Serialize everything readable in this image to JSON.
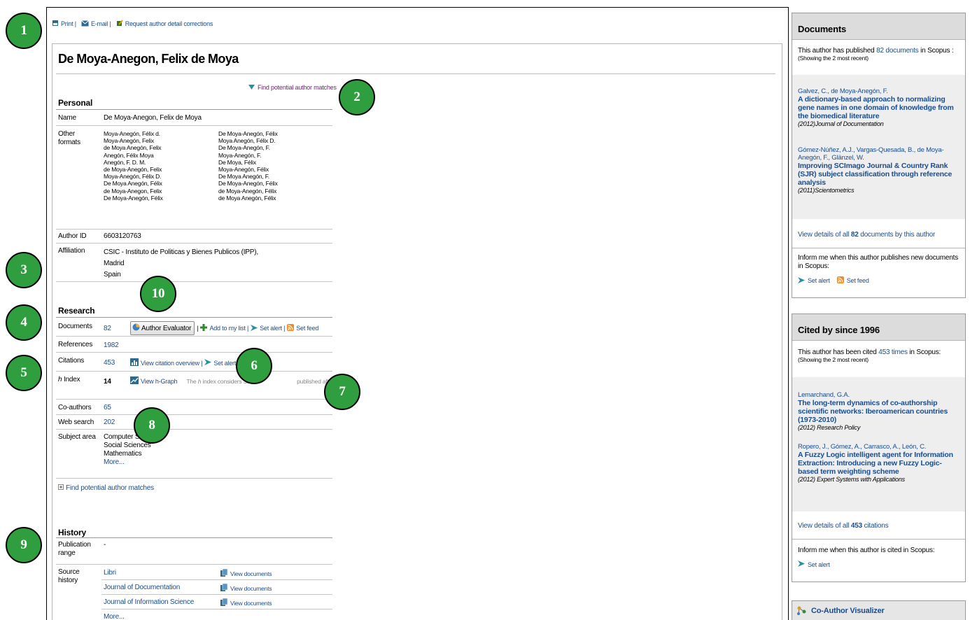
{
  "toolbar": {
    "print": "Print |",
    "email": "E-mail |",
    "request": "Request author detail corrections"
  },
  "author_name": "De Moya-Anegon, Felix de Moya",
  "find_matches_top": "Find potential author matches",
  "personal": {
    "heading": "Personal",
    "name_label": "Name",
    "name_value": "De Moya-Anegon, Felix de Moya",
    "other_label_1": "Other",
    "other_label_2": "formats",
    "formats_col1": [
      "Moya-Anegón, Félix d.",
      "Moya-Anegón, Felix",
      "de Moya Anegón, Felix",
      "Anegón, Félix Moya",
      "Anegón, F. D. M.",
      "de Moya-Anegón, Felix",
      "Moya-Anegón, Félix D.",
      "De Moya Anegón, Félix",
      "de Moya-Anegon, Felix",
      "De Moya-Anegón, Félix"
    ],
    "formats_col2": [
      "De Moya-Anegón, Félix",
      "Moya Anegón, Félix D.",
      "De Moya-Anegón, F.",
      "Moya-Anegón, F.",
      "De Moya, Félix",
      "Moya-Anegón, Félix",
      "De Moya Anegón, F.",
      "De Moya-Anegón, Félix",
      "de Moya-Anegón, Félix",
      "de Moya Anegón, Félix"
    ],
    "author_id_label": "Author ID",
    "author_id": "6603120763",
    "affiliation_label": "Affiliation",
    "affiliation": [
      "CSIC - Instituto de Politicas y Bienes Publicos (IPP),",
      "Madrid",
      "Spain"
    ]
  },
  "research": {
    "heading": "Research",
    "documents_label": "Documents",
    "documents_value": "82",
    "author_evaluator": "Author Evaluator",
    "sep1": "|",
    "add_to_list": "Add to my list |",
    "set_alert_docs": "Set alert |",
    "set_feed": "Set feed",
    "references_label": "References",
    "references_value": "1982",
    "citations_label": "Citations",
    "citations_value": "453",
    "view_citation_overview": "View citation overview |",
    "set_alert_cit": "Set alert",
    "hindex_label_h": "h",
    "hindex_label_rest": " Index",
    "hindex_value": "14",
    "view_hgraph": "View h-Graph",
    "hindex_note_1": "The",
    "hindex_note_h": "h",
    "hindex_note_2": "index considers Sc",
    "hindex_note_3": "published after 1995.",
    "coauthors_label": "Co-authors",
    "coauthors_value": "65",
    "websearch_label": "Web search",
    "websearch_value": "202",
    "subject_label": "Subject area",
    "subjects": [
      "Computer S",
      "Social Sciences",
      "Mathematics"
    ],
    "subjects_more": "More...",
    "find_matches": "Find potential author matches"
  },
  "history": {
    "heading": "History",
    "pub_label_1": "Publication",
    "pub_label_2": "range",
    "pub_value": "-",
    "source_label_1": "Source",
    "source_label_2": "history",
    "sources": [
      "Libri",
      "Journal of Documentation",
      "Journal of Information Science"
    ],
    "view_documents": "View documents",
    "more": "More..."
  },
  "documents_panel": {
    "title": "Documents",
    "intro_1": "This author has published",
    "intro_link": "82 documents",
    "intro_2": "in Scopus :",
    "showing": "(Showing the 2 most recent)",
    "items": [
      {
        "authors": "Galvez, C., de Moya-Anegón, F.",
        "title": "A dictionary-based approach to normalizing gene names in one domain of knowledge from the biomedical literature",
        "source": "(2012)Journal of Documentation"
      },
      {
        "authors": "Gómez-Núñez, A.J., Vargas-Quesada, B., de Moya-Anegón, F., Glänzel, W.",
        "title": "Improving SCImago Journal & Country Rank (SJR) subject classification through reference analysis",
        "source": "(2011)Scientometrics"
      }
    ],
    "view_all_1": "View details of all",
    "view_all_bold": "82",
    "view_all_2": "documents by this author",
    "inform": "Inform me when this author publishes new documents in Scopus:",
    "set_alert": "Set alert",
    "set_feed": "Set feed"
  },
  "cited_panel": {
    "title": "Cited by since 1996",
    "intro_1": "This author has been cited",
    "intro_link": "453 times",
    "intro_2": "in Scopus:",
    "showing": "(Showing the 2 most recent)",
    "items": [
      {
        "authors": "Lemarchand, G.A.",
        "title": "The long-term dynamics of co-authorship scientific networks: Iberoamerican countries (1973-2010)",
        "source": "(2012) Research Policy"
      },
      {
        "authors": "Ropero, J., Gómez, A., Carrasco, A., León, C.",
        "title": "A Fuzzy Logic intelligent agent for Information Extraction: Introducing a new Fuzzy Logic-based term weighting scheme",
        "source": "(2012) Expert Systems with Applications"
      }
    ],
    "view_all_1": "View details of all",
    "view_all_bold": "453",
    "view_all_2": "citations",
    "inform": "Inform me when this author is cited in Scopus:",
    "set_alert": "Set alert"
  },
  "coauthor_visualizer": "Co-Author Visualizer",
  "markers": [
    "1",
    "2",
    "3",
    "4",
    "5",
    "6",
    "7",
    "8",
    "9",
    "10"
  ],
  "colors": {
    "link": "#1a4d8f",
    "marker": "#2f9e3e",
    "panel_header": "#dcdcdc",
    "top_link_purple": "#7a1a7a"
  }
}
